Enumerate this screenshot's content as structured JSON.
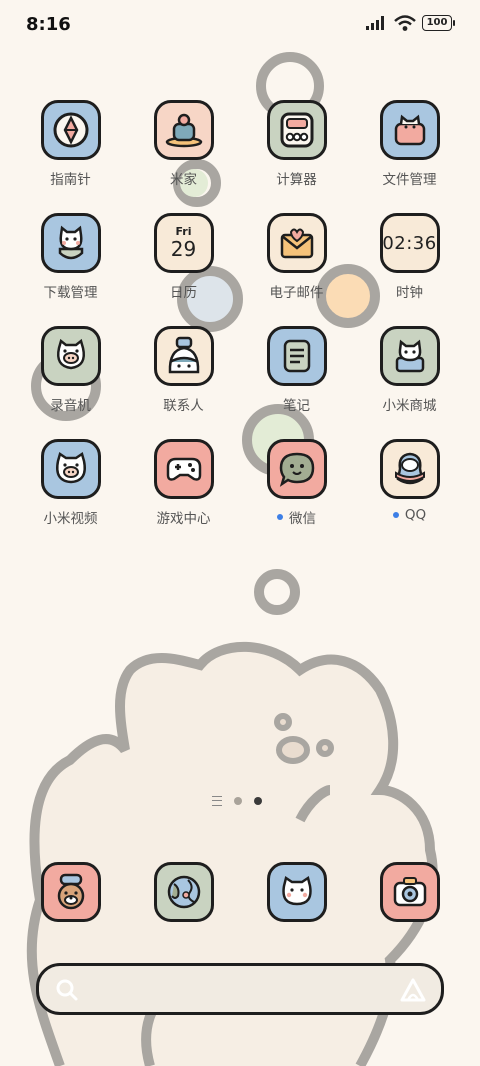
{
  "status_bar": {
    "time": "8:16",
    "battery": "100"
  },
  "apps": [
    {
      "label": "指南针",
      "icon": "compass-icon",
      "bg": "#a9c6e0"
    },
    {
      "label": "米家",
      "icon": "mijia-cake-icon",
      "bg": "#f7d6c6"
    },
    {
      "label": "计算器",
      "icon": "calculator-icon",
      "bg": "#c9d3c1"
    },
    {
      "label": "文件管理",
      "icon": "file-folder-cat-icon",
      "bg": "#a9c6e0"
    },
    {
      "label": "下载管理",
      "icon": "download-cat-icon",
      "bg": "#a9c6e0"
    },
    {
      "label": "日历",
      "icon": "calendar-icon",
      "bg": "#f8ead8",
      "day": "Fri",
      "date": "29"
    },
    {
      "label": "电子邮件",
      "icon": "mail-envelope-icon",
      "bg": "#f8ead8"
    },
    {
      "label": "时钟",
      "icon": "clock-icon",
      "bg": "#f8ead8",
      "time": "02:36"
    },
    {
      "label": "录音机",
      "icon": "recorder-pig-icon",
      "bg": "#c9d3c1"
    },
    {
      "label": "联系人",
      "icon": "contacts-kid-icon",
      "bg": "#f8ead8"
    },
    {
      "label": "笔记",
      "icon": "notes-icon",
      "bg": "#a9c6e0"
    },
    {
      "label": "小米商城",
      "icon": "mi-store-cat-icon",
      "bg": "#c9d3c1"
    },
    {
      "label": "小米视频",
      "icon": "mi-video-pig-icon",
      "bg": "#a9c6e0"
    },
    {
      "label": "游戏中心",
      "icon": "gamepad-icon",
      "bg": "#f2aaa0"
    },
    {
      "label": "微信",
      "icon": "wechat-bubble-icon",
      "bg": "#f2aaa0",
      "notify": true
    },
    {
      "label": "QQ",
      "icon": "qq-penguin-icon",
      "bg": "#f8ead8",
      "notify": true
    }
  ],
  "dock": [
    {
      "name": "dock-phone",
      "icon": "phone-dog-icon",
      "bg": "#f2aaa0"
    },
    {
      "name": "dock-browser",
      "icon": "globe-browser-icon",
      "bg": "#c9d3c1"
    },
    {
      "name": "dock-messages",
      "icon": "messages-cat-icon",
      "bg": "#a9c6e0"
    },
    {
      "name": "dock-camera",
      "icon": "camera-icon",
      "bg": "#f2aaa0"
    }
  ],
  "search": {
    "placeholder": ""
  },
  "colors": {
    "background": "#fbf6ef",
    "outline": "#1e1e1e",
    "accent_blue": "#3d7fe6"
  }
}
